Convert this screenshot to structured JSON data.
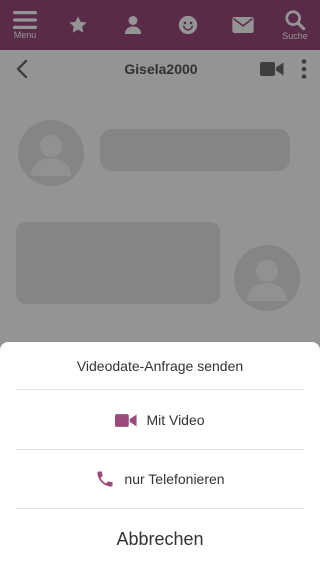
{
  "colors": {
    "brand": "#9b4a7c",
    "icon_header": "#6b6b6b",
    "bubble": "#e6e6e6"
  },
  "nav": {
    "menu_label": "Menu",
    "search_label": "Suche",
    "icons": [
      "menu-icon",
      "star-icon",
      "person-icon",
      "smiley-icon",
      "envelope-icon",
      "search-icon"
    ]
  },
  "chat": {
    "partner_name": "Gisela2000"
  },
  "sheet": {
    "title": "Videodate-Anfrage senden",
    "option_video": "Mit Video",
    "option_phone": "nur Telefonieren",
    "cancel": "Abbrechen"
  }
}
